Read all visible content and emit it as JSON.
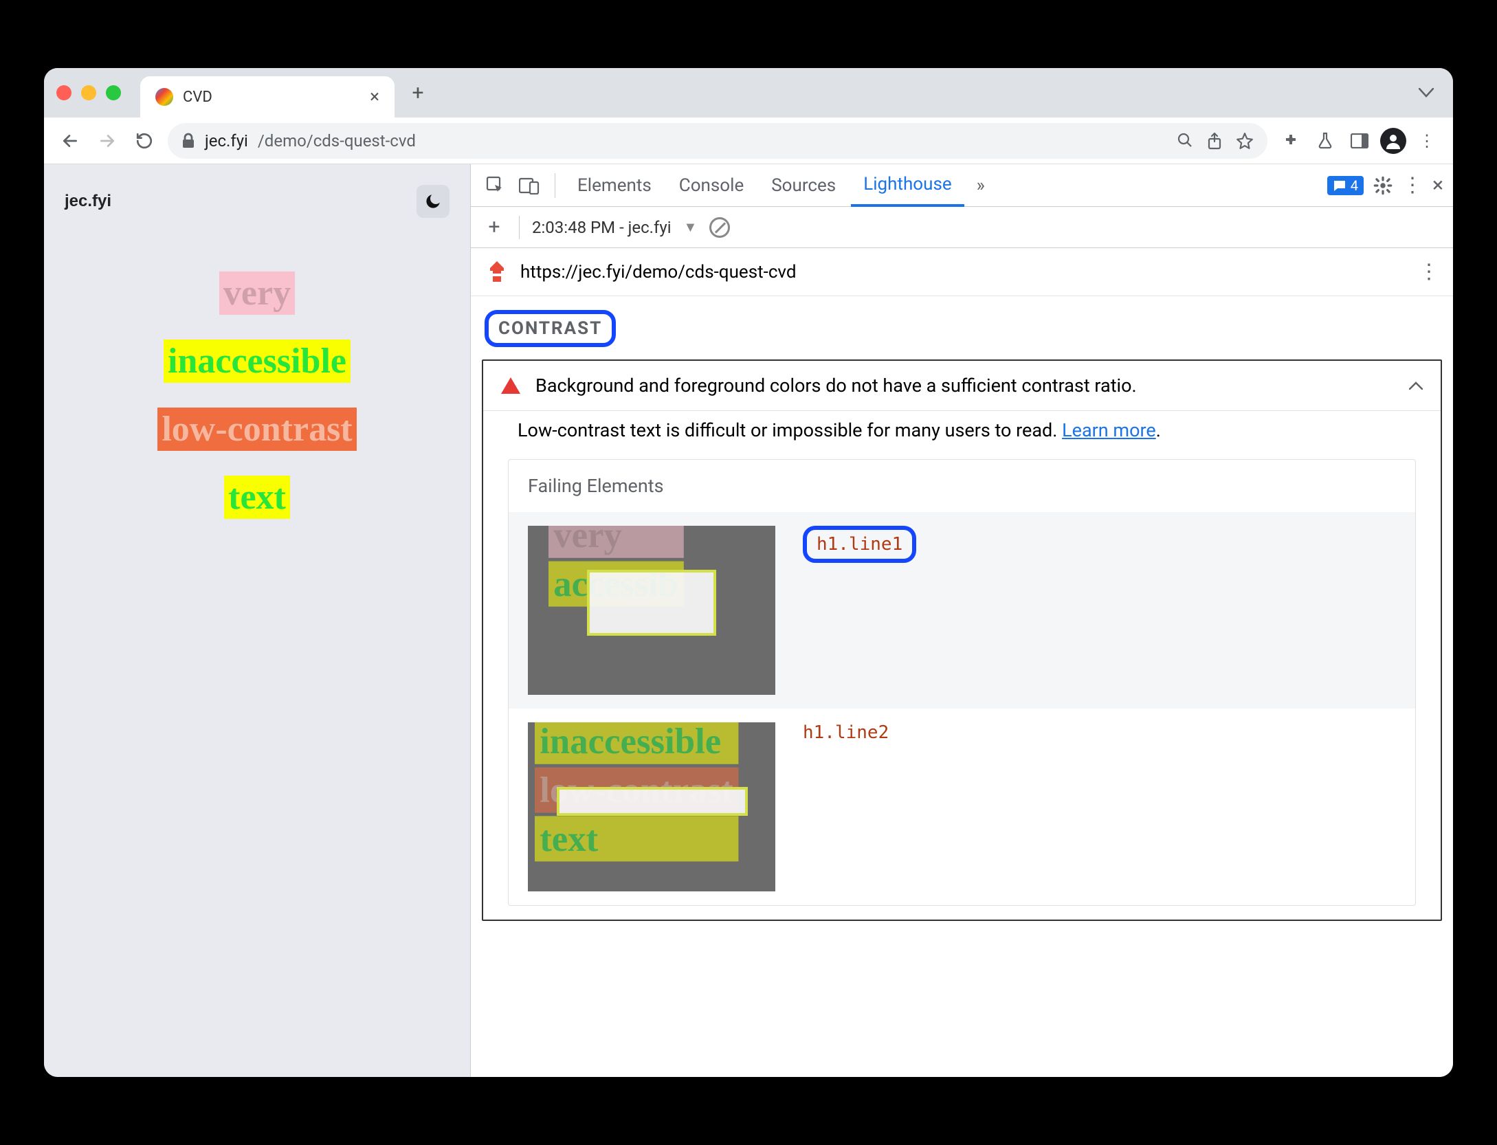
{
  "browser": {
    "tab_title": "CVD",
    "url_host": "jec.fyi",
    "url_path": "/demo/cds-quest-cvd"
  },
  "page": {
    "site_title": "jec.fyi",
    "lines": {
      "l1": "very",
      "l2": "inaccessible",
      "l3": "low-contrast",
      "l4": "text"
    }
  },
  "devtools": {
    "tabs": {
      "elements": "Elements",
      "console": "Console",
      "sources": "Sources",
      "lighthouse": "Lighthouse"
    },
    "issues_count": "4",
    "lh_toolbar": {
      "timestamp": "2:03:48 PM - jec.fyi"
    },
    "lh_url": "https://jec.fyi/demo/cds-quest-cvd",
    "contrast_label": "CONTRAST",
    "audit": {
      "title": "Background and foreground colors do not have a sufficient contrast ratio.",
      "desc_text": "Low-contrast text is difficult or impossible for many users to read. ",
      "learn_more": "Learn more",
      "period": "."
    },
    "failing": {
      "title": "Failing Elements",
      "items": [
        {
          "selector": "h1.line1"
        },
        {
          "selector": "h1.line2"
        }
      ]
    }
  }
}
